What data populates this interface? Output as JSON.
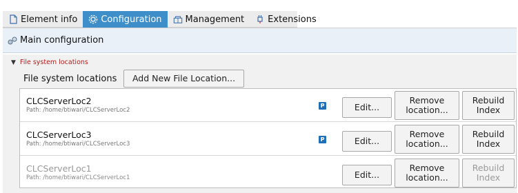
{
  "tabs": [
    {
      "label": "Element info",
      "icon": "document-icon",
      "active": false
    },
    {
      "label": "Configuration",
      "icon": "gear-icon",
      "active": true
    },
    {
      "label": "Management",
      "icon": "management-icon",
      "active": false
    },
    {
      "label": "Extensions",
      "icon": "plugin-icon",
      "active": false
    }
  ],
  "section": {
    "title": "Main configuration",
    "icon": "cogs-icon"
  },
  "group": {
    "toggle_label": "File system locations",
    "row_label": "File system locations",
    "add_button": "Add New File Location..."
  },
  "locations": [
    {
      "name": "CLCServerLoc2",
      "path": "Path: /home/btiwari/CLCServerLoc2",
      "badge": "P",
      "edit": "Edit...",
      "remove": "Remove location...",
      "rebuild": "Rebuild Index",
      "rebuild_enabled": true
    },
    {
      "name": "CLCServerLoc3",
      "path": "Path: /home/btiwari/CLCServerLoc3",
      "badge": "P",
      "edit": "Edit...",
      "remove": "Remove location...",
      "rebuild": "Rebuild Index",
      "rebuild_enabled": true
    },
    {
      "name": "CLCServerLoc1",
      "path": "Path: /home/btiwari/CLCServerLoc1",
      "badge": "",
      "edit": "Edit...",
      "remove": "Remove location...",
      "rebuild": "Rebuild Index",
      "rebuild_enabled": false
    }
  ],
  "colors": {
    "active_tab": "#3d8ec9",
    "header_bg": "#e9f0f8",
    "group_label": "#b31d1d",
    "badge": "#1f6fb8"
  }
}
